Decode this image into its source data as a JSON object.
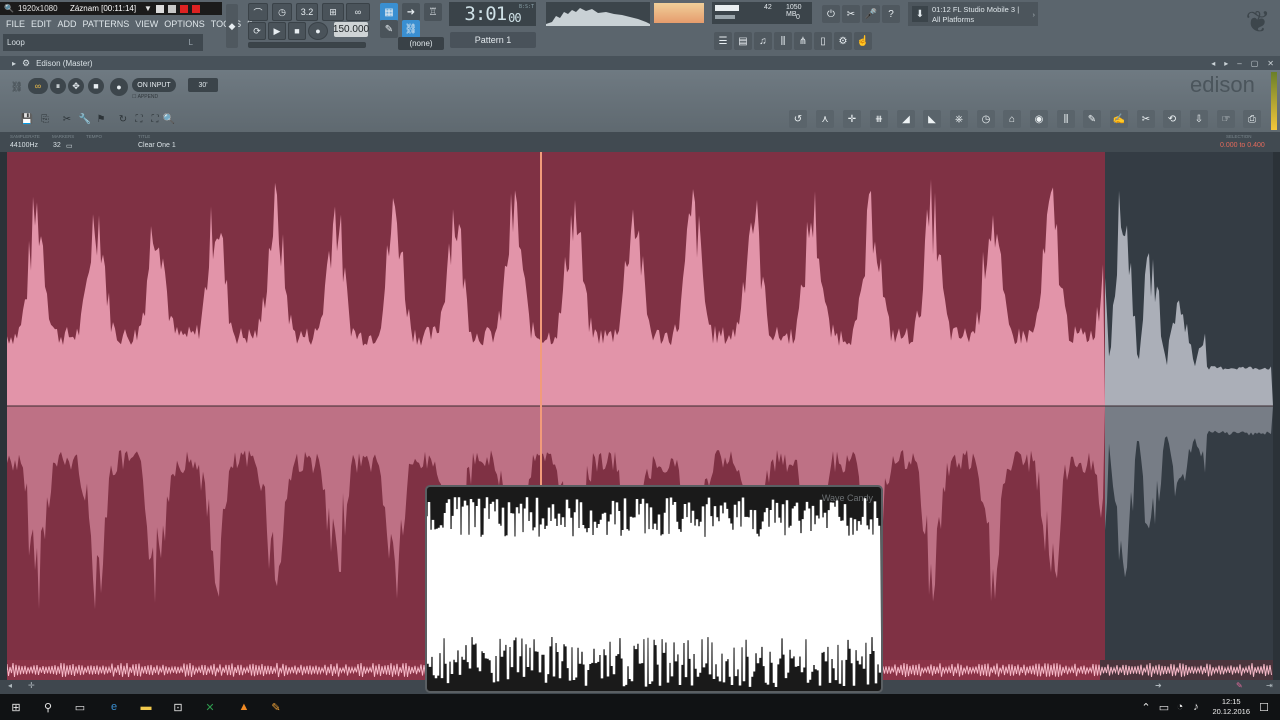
{
  "recorder": {
    "resolution": "1920x1080",
    "recording": "Záznam [00:11:14]"
  },
  "menu": {
    "items": [
      "FILE",
      "EDIT",
      "ADD",
      "PATTERNS",
      "VIEW",
      "OPTIONS",
      "TOOLS",
      "?"
    ]
  },
  "hint": {
    "text": "Loop",
    "shortcut": "L"
  },
  "toolbar": {
    "tempo": "150.000",
    "time_main": "3:01",
    "time_ms": "00",
    "time_mode": "B:S:T",
    "pattern": "Pattern 1",
    "none_selector": "(none)",
    "cpu_value": "42",
    "ram_value": "1050 MB",
    "poly_value": "0"
  },
  "news": {
    "line1": "01:12 FL Studio Mobile 3 |",
    "line2": "All Platforms"
  },
  "edison": {
    "title": "Edison (Master)",
    "logo": "edison",
    "on_input": "ON INPUT",
    "time_limit": "30'",
    "on_input_sub": "☐ APPEND",
    "info": {
      "samplerate_label": "SAMPLERATE",
      "samplerate": "44100Hz",
      "markers_label": "MARKERS",
      "markers": "32",
      "tempo_label": "TEMPO",
      "title_label": "TITLE",
      "title": "Clear One 1",
      "selection_label": "SELECTION",
      "selection": "0.000 to 0.400"
    }
  },
  "wavecandy": {
    "title": "Wave Candy"
  },
  "taskbar": {
    "time": "12:15",
    "date": "20.12.2016"
  },
  "colors": {
    "selection_bg": "#7f3144",
    "wave_pink": "#f3a6bb",
    "wave_gray": "#c9ccd6",
    "playhead": "#f29b7a",
    "accent_blue": "#3a8fd1"
  }
}
